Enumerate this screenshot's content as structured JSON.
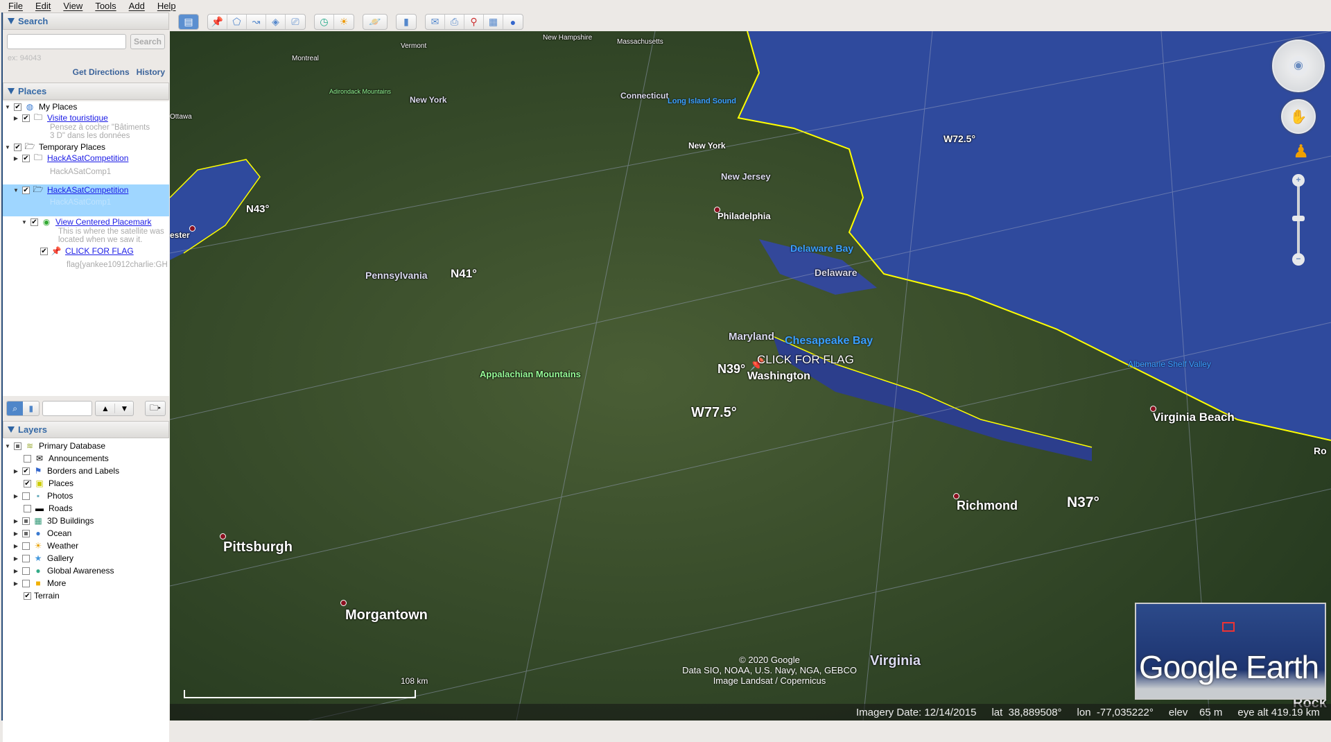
{
  "menu": [
    "File",
    "Edit",
    "View",
    "Tools",
    "Add",
    "Help"
  ],
  "search": {
    "title": "Search",
    "placeholder": "",
    "button": "Search",
    "example": "ex: 94043",
    "get_directions": "Get Directions",
    "history": "History"
  },
  "places": {
    "title": "Places",
    "items": [
      {
        "label": "My Places",
        "checked": true
      },
      {
        "label": "Visite touristique",
        "desc1": "Pensez à cocher \"Bâtiments",
        "desc2": "3 D\" dans les données"
      },
      {
        "label": "Temporary Places"
      },
      {
        "label": "HackASatCompetition",
        "desc1": "HackASatComp1"
      },
      {
        "label": "HackASatCompetition",
        "desc1": "HackASatComp1"
      },
      {
        "label": "View Centered Placemark",
        "desc1": "This is where the satellite was",
        "desc2": "located when we saw it."
      },
      {
        "label": "CLICK FOR FLAG",
        "desc1": "flag{yankee10912charlie:GH"
      }
    ]
  },
  "layers": {
    "title": "Layers",
    "items": [
      {
        "label": "Primary Database",
        "state": "partial"
      },
      {
        "label": "Announcements",
        "state": "off"
      },
      {
        "label": "Borders and Labels",
        "state": "on"
      },
      {
        "label": "Places",
        "state": "on"
      },
      {
        "label": "Photos",
        "state": "off"
      },
      {
        "label": "Roads",
        "state": "off"
      },
      {
        "label": "3D Buildings",
        "state": "partial"
      },
      {
        "label": "Ocean",
        "state": "partial"
      },
      {
        "label": "Weather",
        "state": "off"
      },
      {
        "label": "Gallery",
        "state": "off"
      },
      {
        "label": "Global Awareness",
        "state": "off"
      },
      {
        "label": "More",
        "state": "off"
      },
      {
        "label": "Terrain",
        "state": "on"
      }
    ]
  },
  "map": {
    "labels": {
      "montreal": "Montreal",
      "vermont": "Vermont",
      "new_hampshire": "New Hampshire",
      "massachusetts": "Massachusetts",
      "adirondack": "Adirondack Mountains",
      "new_york_state": "New York",
      "connecticut": "Connecticut",
      "long_island": "Long Island Sound",
      "ottawa": "Ottawa",
      "new_york_city": "New York",
      "w725": "W72.5°",
      "new_jersey": "New Jersey",
      "n43": "N43°",
      "philadelphia": "Philadelphia",
      "rochester": "ester",
      "delaware_bay": "Delaware Bay",
      "delaware": "Delaware",
      "pennsylvania": "Pennsylvania",
      "n41": "N41°",
      "maryland": "Maryland",
      "chesapeake": "Chesapeake Bay",
      "flag": "CLICK FOR FLAG",
      "n39": "N39°",
      "washington": "Washington",
      "albemarle": "Albemarle Shelf Valley",
      "appalachian": "Appalachian Mountains",
      "w775": "W77.5°",
      "virginia_beach": "Virginia Beach",
      "richmond": "Richmond",
      "n37": "N37°",
      "pittsburgh": "Pittsburgh",
      "morgantown": "Morgantown",
      "virginia": "Virginia",
      "roanoke": "Ro",
      "rock": "Rock"
    },
    "attribution": [
      "© 2020 Google",
      "Data SIO, NOAA, U.S. Navy, NGA, GEBCO",
      "Image Landsat / Copernicus"
    ],
    "scale": "108 km",
    "logo": "Google Earth"
  },
  "status": {
    "imagery_date": "Imagery Date: 12/14/2015",
    "lat_label": "lat",
    "lat": "38,889508°",
    "lon_label": "lon",
    "lon": "-77,035222°",
    "elev_label": "elev",
    "elev": "65 m",
    "eye": "eye alt 419.19 km"
  },
  "colors": {
    "accent": "#3569a6",
    "selection": "#9fd6ff",
    "ocean": "#2e4aa0",
    "coast": "#ffff00"
  }
}
